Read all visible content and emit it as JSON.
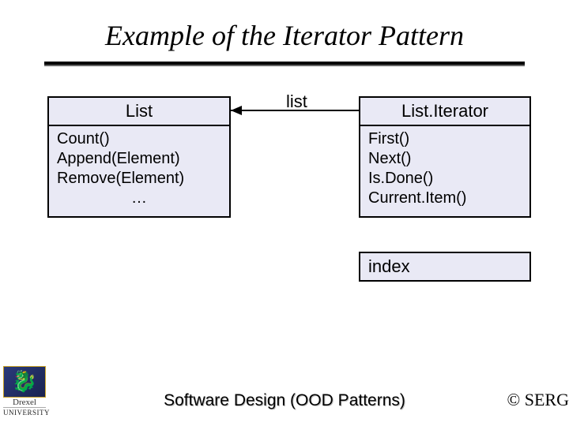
{
  "title": "Example of the Iterator Pattern",
  "association_label": "list",
  "left_class": {
    "name": "List",
    "ops": [
      "Count()",
      "Append(Element)",
      "Remove(Element)"
    ],
    "ellipsis": "…"
  },
  "right_class": {
    "name": "List.Iterator",
    "ops": [
      "First()",
      "Next()",
      "Is.Done()",
      "Current.Item()"
    ]
  },
  "extra_box": "index",
  "footer": {
    "logo_uni": "UNIVERSITY",
    "logo_name": "Drexel",
    "center": "Software Design (OOD Patterns)",
    "right": "© SERG"
  }
}
